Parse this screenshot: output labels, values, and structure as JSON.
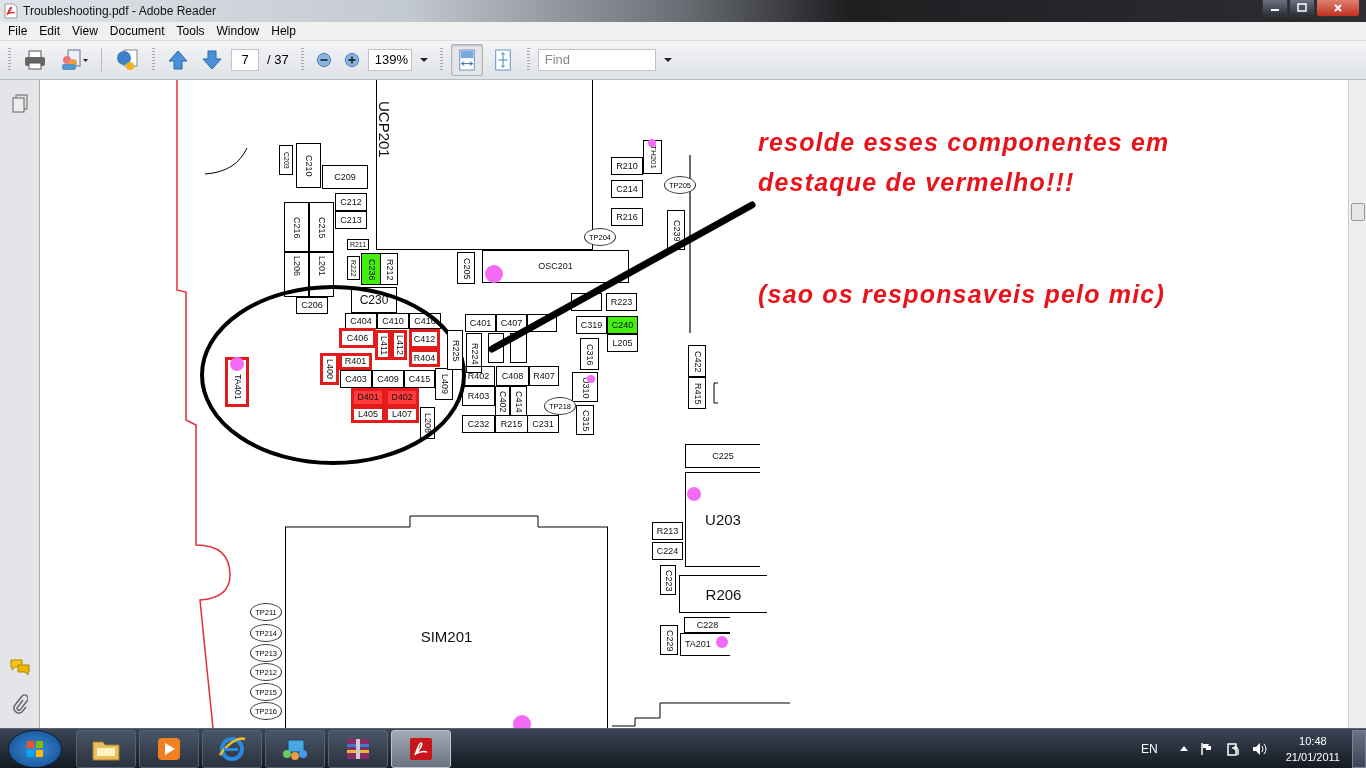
{
  "window": {
    "title": "Troubleshooting.pdf - Adobe Reader"
  },
  "menu": [
    "File",
    "Edit",
    "View",
    "Document",
    "Tools",
    "Window",
    "Help"
  ],
  "toolbar": {
    "page_number": "7",
    "page_total": "/ 37",
    "zoom": "139%",
    "find_placeholder": "Find",
    "view_buttons": [
      {
        "selected": true
      },
      {
        "selected": false
      }
    ]
  },
  "document": {
    "components": [
      {
        "label": "C203",
        "highlighted": false
      },
      {
        "label": "C210",
        "highlighted": false
      },
      {
        "label": "C209",
        "highlighted": false
      },
      {
        "label": "C212",
        "highlighted": false
      },
      {
        "label": "C213",
        "highlighted": false
      },
      {
        "label": "C216",
        "highlighted": false
      },
      {
        "label": "C215",
        "highlighted": false
      },
      {
        "label": "R211",
        "highlighted": false
      },
      {
        "label": "L206",
        "highlighted": false
      },
      {
        "label": "L201",
        "highlighted": false
      },
      {
        "label": "R222",
        "highlighted": false
      },
      {
        "label": "C236",
        "highlighted": false,
        "color": "#44ee11"
      },
      {
        "label": "R212",
        "highlighted": false
      },
      {
        "label": "C205",
        "highlighted": false
      },
      {
        "label": "OSC201",
        "highlighted": false
      },
      {
        "label": "C206",
        "highlighted": false
      },
      {
        "label": "C230",
        "highlighted": false
      },
      {
        "label": "C404",
        "highlighted": false
      },
      {
        "label": "C410",
        "highlighted": false
      },
      {
        "label": "C416",
        "highlighted": false
      },
      {
        "label": "C406",
        "highlighted": true
      },
      {
        "label": "L411",
        "highlighted": true
      },
      {
        "label": "L412",
        "highlighted": true
      },
      {
        "label": "C412",
        "highlighted": true
      },
      {
        "label": "R404",
        "highlighted": true
      },
      {
        "label": "R401",
        "highlighted": true
      },
      {
        "label": "L400",
        "highlighted": true
      },
      {
        "label": "C403",
        "highlighted": false
      },
      {
        "label": "C409",
        "highlighted": false
      },
      {
        "label": "C415",
        "highlighted": false
      },
      {
        "label": "L409",
        "highlighted": false
      },
      {
        "label": "D401",
        "highlighted": true,
        "color": "#ff3b3b"
      },
      {
        "label": "D402",
        "highlighted": true,
        "color": "#ff3b3b"
      },
      {
        "label": "L405",
        "highlighted": true
      },
      {
        "label": "L407",
        "highlighted": true
      },
      {
        "label": "L208",
        "highlighted": false
      },
      {
        "label": "TA401",
        "highlighted": true
      },
      {
        "label": "R225",
        "highlighted": false
      },
      {
        "label": "R224",
        "highlighted": false
      },
      {
        "label": "C401",
        "highlighted": false
      },
      {
        "label": "C407",
        "highlighted": false
      },
      {
        "label": "R402",
        "highlighted": false
      },
      {
        "label": "C408",
        "highlighted": false
      },
      {
        "label": "R407",
        "highlighted": false
      },
      {
        "label": "R403",
        "highlighted": false
      },
      {
        "label": "C402",
        "highlighted": false
      },
      {
        "label": "C414",
        "highlighted": false
      },
      {
        "label": "C232",
        "highlighted": false
      },
      {
        "label": "R215",
        "highlighted": false
      },
      {
        "label": "C231",
        "highlighted": false
      },
      {
        "label": "R210",
        "highlighted": false
      },
      {
        "label": "TH201",
        "highlighted": false
      },
      {
        "label": "C214",
        "highlighted": false
      },
      {
        "label": "R216",
        "highlighted": false
      },
      {
        "label": "C239",
        "highlighted": false
      },
      {
        "label": "R223",
        "highlighted": false
      },
      {
        "label": "C319",
        "highlighted": false
      },
      {
        "label": "C240",
        "highlighted": false,
        "color": "#44ee11"
      },
      {
        "label": "L205",
        "highlighted": false
      },
      {
        "label": "C316",
        "highlighted": false
      },
      {
        "label": "U310",
        "highlighted": false
      },
      {
        "label": "C315",
        "highlighted": false
      },
      {
        "label": "C422",
        "highlighted": false
      },
      {
        "label": "R415",
        "highlighted": false
      },
      {
        "label": "C225",
        "highlighted": false
      },
      {
        "label": "U203",
        "highlighted": false
      },
      {
        "label": "R213",
        "highlighted": false
      },
      {
        "label": "C224",
        "highlighted": false
      },
      {
        "label": "C223",
        "highlighted": false
      },
      {
        "label": "R206",
        "highlighted": false
      },
      {
        "label": "C228",
        "highlighted": false
      },
      {
        "label": "C229",
        "highlighted": false
      },
      {
        "label": "TA201",
        "highlighted": false
      },
      {
        "label": "UCP201",
        "highlighted": false
      },
      {
        "label": "SIM201",
        "highlighted": false
      }
    ],
    "test_points": [
      {
        "label": "TP218"
      },
      {
        "label": "TP205"
      },
      {
        "label": "TP204"
      },
      {
        "label": "TP211"
      },
      {
        "label": "TP214"
      },
      {
        "label": "TP213"
      },
      {
        "label": "TP212"
      },
      {
        "label": "TP215"
      },
      {
        "label": "TP216"
      }
    ],
    "annotations": [
      "resolde esses componentes em destaque de vermelho!!!",
      "(sao os responsaveis pelo mic)"
    ]
  },
  "taskbar": {
    "apps": [
      {
        "kind": "folder",
        "selected": false
      },
      {
        "kind": "media",
        "selected": false
      },
      {
        "kind": "browser",
        "selected": false
      },
      {
        "kind": "network",
        "selected": false
      },
      {
        "kind": "archive",
        "selected": false
      },
      {
        "kind": "pdf",
        "selected": true
      }
    ],
    "language": "EN",
    "time": "10:48",
    "date": "21/01/2011"
  }
}
